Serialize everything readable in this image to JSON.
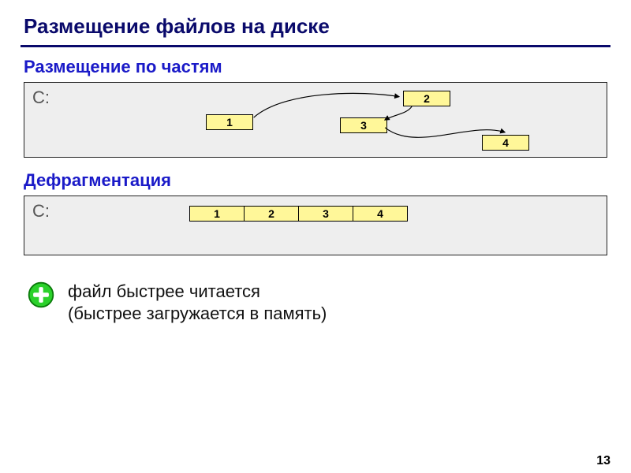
{
  "title": "Размещение файлов на диске",
  "section1": "Размещение по частям",
  "section2": "Дефрагментация",
  "driveLabel": "C:",
  "fragmented": {
    "blocks": [
      "1",
      "2",
      "3",
      "4"
    ]
  },
  "defrag": {
    "blocks": [
      "1",
      "2",
      "3",
      "4"
    ]
  },
  "note": {
    "line1": "файл быстрее читается",
    "line2": "(быстрее загружается в память)"
  },
  "pageNumber": "13"
}
